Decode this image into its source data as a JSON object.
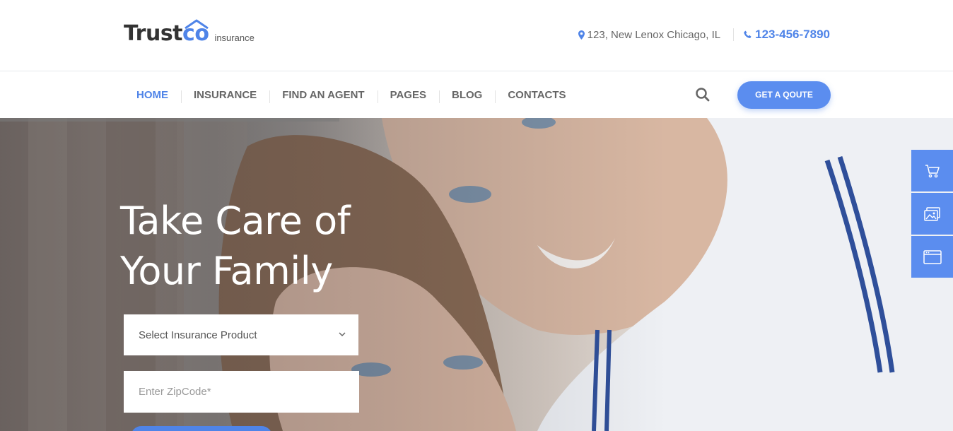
{
  "header": {
    "logo": {
      "text_main": "Trust",
      "text_accent": "co",
      "subtitle": "insurance"
    },
    "address": "123, New Lenox Chicago, IL",
    "phone": "123-456-7890"
  },
  "nav": {
    "items": [
      {
        "label": "HOME",
        "active": true
      },
      {
        "label": "INSURANCE",
        "active": false
      },
      {
        "label": "FIND AN AGENT",
        "active": false
      },
      {
        "label": "PAGES",
        "active": false
      },
      {
        "label": "BLOG",
        "active": false
      },
      {
        "label": "CONTACTS",
        "active": false
      }
    ],
    "cta_label": "GET A QOUTE"
  },
  "hero": {
    "title_line1": "Take Care of",
    "title_line2": "Your Family",
    "product_select": {
      "value": "Select Insurance Product"
    },
    "zip_input": {
      "placeholder": "Enter ZipCode*",
      "value": ""
    }
  },
  "side_widgets": [
    {
      "icon": "cart-icon"
    },
    {
      "icon": "gallery-icon"
    },
    {
      "icon": "browser-window-icon"
    }
  ],
  "colors": {
    "accent": "#4f84e8",
    "button": "#5b8def",
    "text_gray": "#666666"
  }
}
